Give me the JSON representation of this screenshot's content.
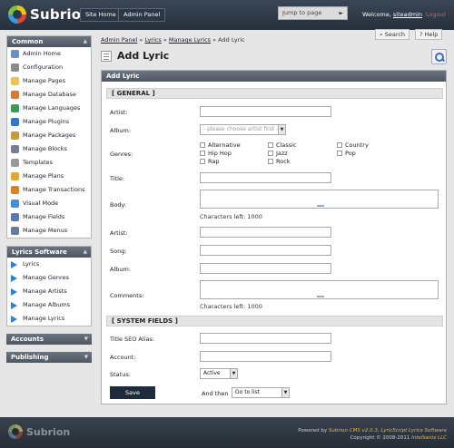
{
  "header": {
    "logo_text": "Subrion",
    "site_home": "Site Home",
    "admin_panel": "Admin Panel",
    "jump_to_page": "Jump to page",
    "welcome": "Welcome,",
    "username": "siteadmin",
    "logout": "Logout"
  },
  "toolbar": {
    "search": "Search",
    "help": "Help"
  },
  "sidebar": {
    "common_title": "Common",
    "common_items": [
      {
        "label": "Admin Home",
        "icon": "home-icon"
      },
      {
        "label": "Configuration",
        "icon": "wrench-icon"
      },
      {
        "label": "Manage Pages",
        "icon": "pages-icon"
      },
      {
        "label": "Manage Database",
        "icon": "database-icon"
      },
      {
        "label": "Manage Languages",
        "icon": "globe-icon"
      },
      {
        "label": "Manage Plugins",
        "icon": "plugin-icon"
      },
      {
        "label": "Manage Packages",
        "icon": "package-icon"
      },
      {
        "label": "Manage Blocks",
        "icon": "blocks-icon"
      },
      {
        "label": "Templates",
        "icon": "templates-icon"
      },
      {
        "label": "Manage Plans",
        "icon": "plans-icon"
      },
      {
        "label": "Manage Transactions",
        "icon": "transactions-icon"
      },
      {
        "label": "Visual Mode",
        "icon": "visual-mode-icon"
      },
      {
        "label": "Manage Fields",
        "icon": "fields-icon"
      },
      {
        "label": "Manage Menus",
        "icon": "menus-icon"
      }
    ],
    "lyrics_title": "Lyrics Software",
    "lyrics_items": [
      "Lyrics",
      "Manage Genres",
      "Manage Artists",
      "Manage Albums",
      "Manage Lyrics"
    ],
    "accounts_title": "Accounts",
    "publishing_title": "Publishing"
  },
  "breadcrumb": {
    "admin_panel": "Admin Panel",
    "lyrics": "Lyrics",
    "manage_lyrics": "Manage Lyrics",
    "current": "Add Lyric"
  },
  "page_title": "Add Lyric",
  "panel_title": "Add Lyric",
  "form": {
    "general_section": "[ GENERAL ]",
    "artist_label": "Artist:",
    "album_label": "Album:",
    "album_placeholder": "- please choose artist first -",
    "genres_label": "Genres:",
    "genres": [
      "Alternative",
      "Classic",
      "Country",
      "Hip Hop",
      "Jazz",
      "Pop",
      "Rap",
      "Rock"
    ],
    "title_label": "Title:",
    "body_label": "Body:",
    "chars_left_1": "Characters left: 1000",
    "artist2_label": "Artist:",
    "song_label": "Song:",
    "album2_label": "Album:",
    "comments_label": "Comments:",
    "chars_left_2": "Characters left: 1000",
    "system_section": "[ SYSTEM FIELDS ]",
    "seo_label": "Title SEO Alias:",
    "account_label": "Account:",
    "status_label": "Status:",
    "status_value": "Active",
    "save_button": "Save",
    "and_then_label": "And then",
    "and_then_value": "Go to list"
  },
  "footer": {
    "logo_text": "Subrion",
    "powered_by": "Powered by",
    "cms_link": "Subrion CMS v2.0.3",
    "separator": ",",
    "lyrics_link": "LyricScript Lyrics Software",
    "copyright": "Copyright © 2008-2011",
    "company": "Intelliants LLC"
  },
  "colors": {
    "header_bg": "#2f3a48",
    "panel_head": "#5a626e",
    "link_blue": "#2f7fd6",
    "logout_red": "#e35a4a"
  }
}
